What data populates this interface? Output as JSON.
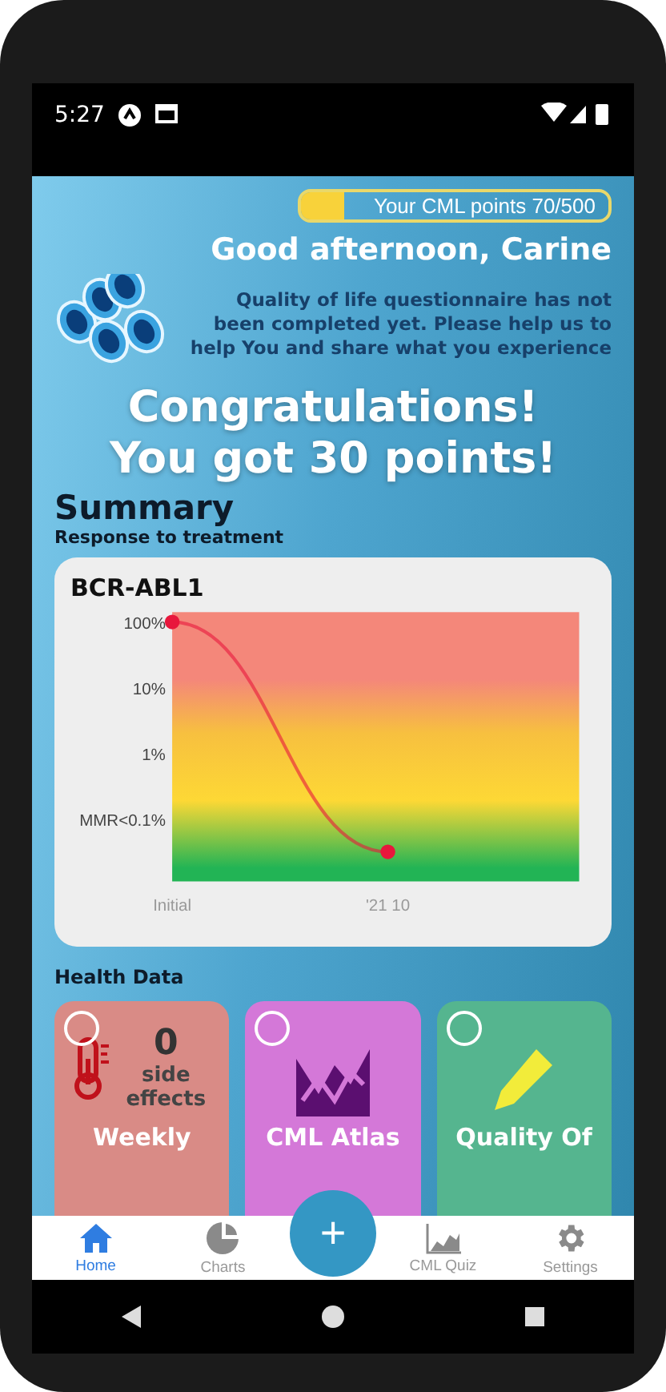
{
  "status_bar": {
    "time": "5:27"
  },
  "points": {
    "label": "Your CML points 70/500",
    "level": 0.14
  },
  "greeting": "Good afternoon, Carine",
  "notice": "Quality of life questionnaire has not been completed yet. Please help us to help You and share what you experience",
  "congrats": [
    "Congratulations!",
    "You got 30 points!"
  ],
  "summary": {
    "title": "Summary",
    "subtitle": "Response to treatment"
  },
  "chart_card": {
    "title": "BCR-ABL1",
    "y_labels": [
      "100%",
      "10%",
      "1%",
      "MMR<0.1%"
    ],
    "x_labels": [
      "Initial",
      "'21 10"
    ]
  },
  "health": {
    "title": "Health Data",
    "cards": [
      {
        "kind": "side_effects",
        "count": "0",
        "label": "side effects",
        "title": "Weekly",
        "color": "#d98b86",
        "checked": false
      },
      {
        "kind": "atlas",
        "title": "CML Atlas",
        "color": "#d478d8",
        "checked": false
      },
      {
        "kind": "quality",
        "title": "Quality Of",
        "color": "#55b58f",
        "checked": false
      }
    ]
  },
  "nav": {
    "fab": "+",
    "items": [
      {
        "kind": "home",
        "label": "Home",
        "selected": true
      },
      {
        "kind": "charts",
        "label": "Charts",
        "selected": false
      },
      {
        "kind": "quiz",
        "label": "CML Quiz",
        "selected": false
      },
      {
        "kind": "settings",
        "label": "Settings",
        "selected": false
      }
    ]
  }
}
